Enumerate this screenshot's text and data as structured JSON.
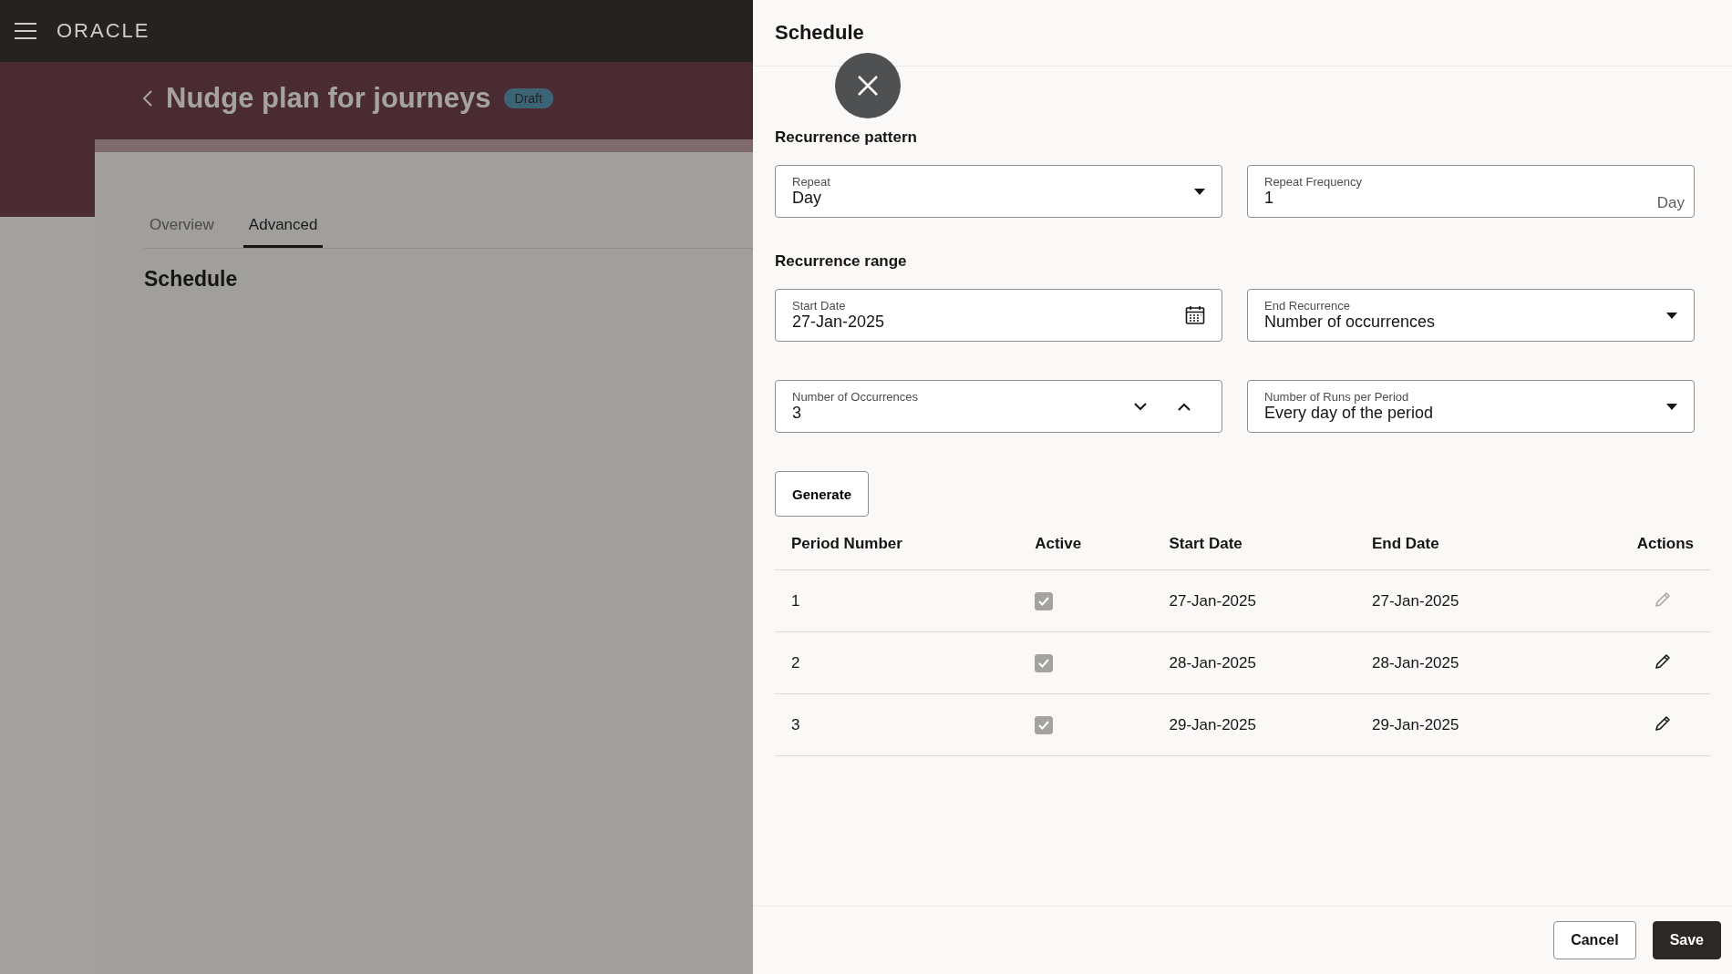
{
  "top_bar": {
    "logo": "ORACLE"
  },
  "page": {
    "title": "Nudge plan for journeys",
    "badge": "Draft",
    "tabs": [
      {
        "label": "Overview",
        "selected": false
      },
      {
        "label": "Advanced",
        "selected": true
      }
    ],
    "section_title": "Schedule"
  },
  "drawer": {
    "title": "Schedule",
    "sections": [
      {
        "heading": "Recurrence pattern",
        "fields": [
          {
            "kind": "select",
            "label": "Repeat",
            "value": "Day"
          },
          {
            "kind": "suffix",
            "label": "Repeat Frequency",
            "value": "1",
            "suffix": "Day"
          }
        ]
      },
      {
        "heading": "Recurrence range",
        "fields": [
          {
            "kind": "date",
            "label": "Start Date",
            "value": "27-Jan-2025"
          },
          {
            "kind": "select",
            "label": "End Recurrence",
            "value": "Number of occurrences"
          },
          {
            "kind": "number",
            "label": "Number of Occurrences",
            "value": "3"
          },
          {
            "kind": "select",
            "label": "Number of Runs per Period",
            "value": "Every day of the period"
          }
        ]
      }
    ],
    "generate_button": "Generate",
    "table": {
      "columns": [
        "Period Number",
        "Active",
        "Start Date",
        "End Date",
        "Actions"
      ],
      "rows": [
        {
          "period": "1",
          "active": true,
          "start": "27-Jan-2025",
          "end": "27-Jan-2025",
          "edit_disabled": true
        },
        {
          "period": "2",
          "active": true,
          "start": "28-Jan-2025",
          "end": "28-Jan-2025",
          "edit_disabled": false
        },
        {
          "period": "3",
          "active": true,
          "start": "29-Jan-2025",
          "end": "29-Jan-2025",
          "edit_disabled": false
        }
      ]
    },
    "footer_buttons": [
      {
        "label": "Cancel",
        "kind": "secondary"
      },
      {
        "label": "Save",
        "kind": "primary"
      }
    ]
  }
}
